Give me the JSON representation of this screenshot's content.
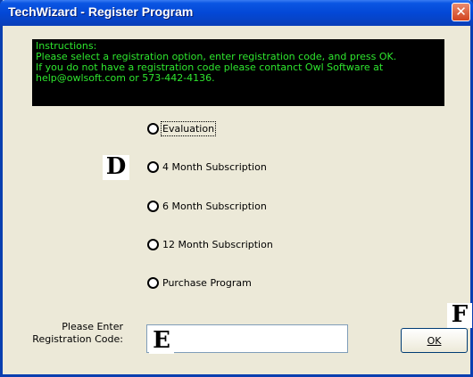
{
  "window": {
    "title": "TechWizard - Register Program",
    "close_glyph": "✕"
  },
  "instructions": {
    "lines": [
      "Instructions:",
      "Please select a registration option, enter registration code, and press OK.",
      "If you do not have a registration code please contanct Owl Software at",
      "help@owlsoft.com or 573-442-4136."
    ],
    "background_color": "#000000",
    "text_color": "#2ee62e"
  },
  "options": [
    {
      "label": "Evaluation",
      "focused": true
    },
    {
      "label": "4 Month Subscription",
      "focused": false
    },
    {
      "label": "6 Month Subscription",
      "focused": false
    },
    {
      "label": "12 Month Subscription",
      "focused": false
    },
    {
      "label": "Purchase Program",
      "focused": false
    }
  ],
  "markers": {
    "d": "D",
    "e": "E",
    "f": "F"
  },
  "registration": {
    "label_line1": "Please Enter",
    "label_line2": "Registration Code:",
    "value": ""
  },
  "ok_button": {
    "label": "OK"
  }
}
